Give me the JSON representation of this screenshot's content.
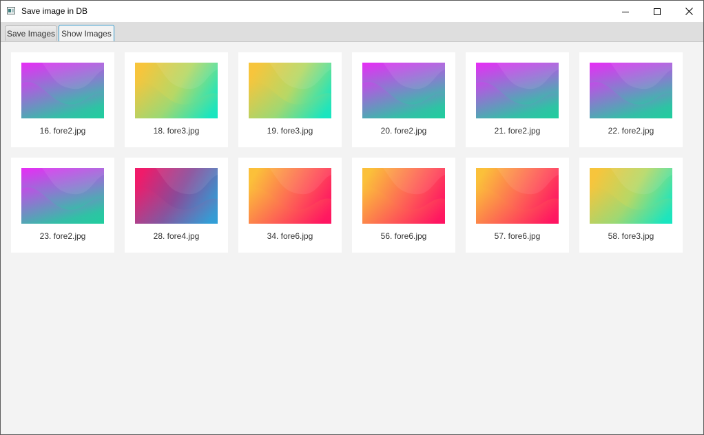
{
  "window": {
    "title": "Save image in DB"
  },
  "tabs": [
    {
      "label": "Save Images",
      "selected": false
    },
    {
      "label": "Show Images",
      "selected": true
    }
  ],
  "images": [
    {
      "caption": "16. fore2.jpg",
      "style": "fore2"
    },
    {
      "caption": "18. fore3.jpg",
      "style": "fore3"
    },
    {
      "caption": "19. fore3.jpg",
      "style": "fore3"
    },
    {
      "caption": "20. fore2.jpg",
      "style": "fore2"
    },
    {
      "caption": "21. fore2.jpg",
      "style": "fore2"
    },
    {
      "caption": "22. fore2.jpg",
      "style": "fore2"
    },
    {
      "caption": "23. fore2.jpg",
      "style": "fore2"
    },
    {
      "caption": "28. fore4.jpg",
      "style": "fore4"
    },
    {
      "caption": "34. fore6.jpg",
      "style": "fore6"
    },
    {
      "caption": "56. fore6.jpg",
      "style": "fore6"
    },
    {
      "caption": "57. fore6.jpg",
      "style": "fore6"
    },
    {
      "caption": "58. fore3.jpg",
      "style": "fore3"
    }
  ],
  "gradients": {
    "fore2": {
      "a": "#e82cf6",
      "b": "#8a7bd0",
      "c": "#20ce9e"
    },
    "fore3": {
      "a": "#f7c53c",
      "b": "#b6d866",
      "c": "#15e6c2"
    },
    "fore4": {
      "a": "#f01b6a",
      "b": "#8a4a98",
      "c": "#2fa0d8"
    },
    "fore6": {
      "a": "#fbc03a",
      "b": "#fd6a54",
      "c": "#ff1162"
    }
  }
}
